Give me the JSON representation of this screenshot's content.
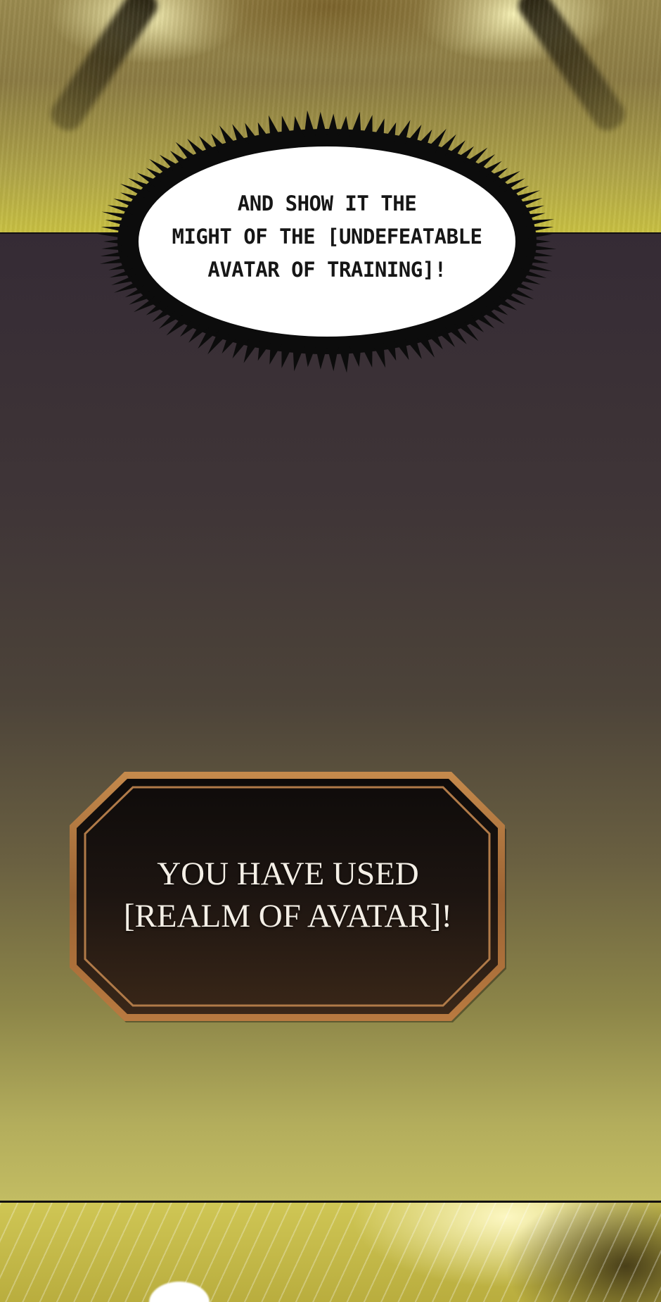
{
  "speech_bubble": {
    "lines": [
      "AND SHOW IT THE",
      "MIGHT OF THE [UNDEFEATABLE",
      "AVATAR OF TRAINING]!"
    ]
  },
  "system_message": {
    "lines": [
      "YOU HAVE USED",
      "[REALM OF AVATAR]!"
    ]
  },
  "colors": {
    "middle_top": "#352b35",
    "middle_bottom": "#c2bc62",
    "box_frame": "#a8703e",
    "box_fill": "#1f1612",
    "gold_panel": "#c8c042"
  }
}
